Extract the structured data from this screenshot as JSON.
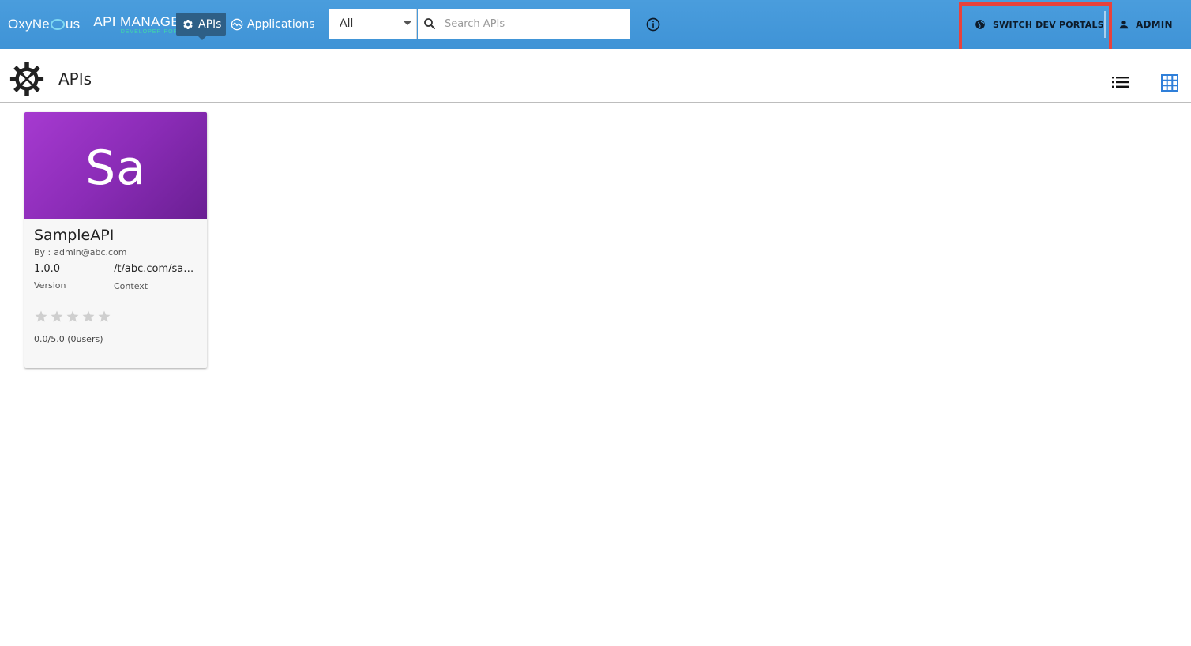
{
  "header": {
    "brand_left": "OxyNe",
    "brand_right": "us",
    "product": "API MANAGER",
    "product_sub": "DEVELOPER PORTAL",
    "nav": [
      {
        "label": "APIs",
        "icon": "gear-icon",
        "active": true
      },
      {
        "label": "Applications",
        "icon": "applications-icon",
        "active": false
      }
    ],
    "search": {
      "filter_value": "All",
      "placeholder": "Search APIs"
    },
    "switch_portals_label": "SWITCH DEV PORTALS",
    "user_label": "ADMIN",
    "colors": {
      "bar": "#4a9ddd",
      "active_nav": "#2e5f86",
      "highlight": "#e8423c"
    }
  },
  "page": {
    "title": "APIs",
    "view_modes": [
      "list-view-icon",
      "grid-view-icon"
    ],
    "active_view": "grid"
  },
  "apis": [
    {
      "thumb_text": "Sa",
      "name": "SampleAPI",
      "author_prefix": "By :",
      "author": "admin@abc.com",
      "version": "1.0.0",
      "version_label": "Version",
      "context": "/t/abc.com/sam...",
      "context_label": "Context",
      "rating": 0,
      "rating_text": "0.0/5.0 (0users)",
      "thumb_color": "#8b2cb7"
    }
  ]
}
